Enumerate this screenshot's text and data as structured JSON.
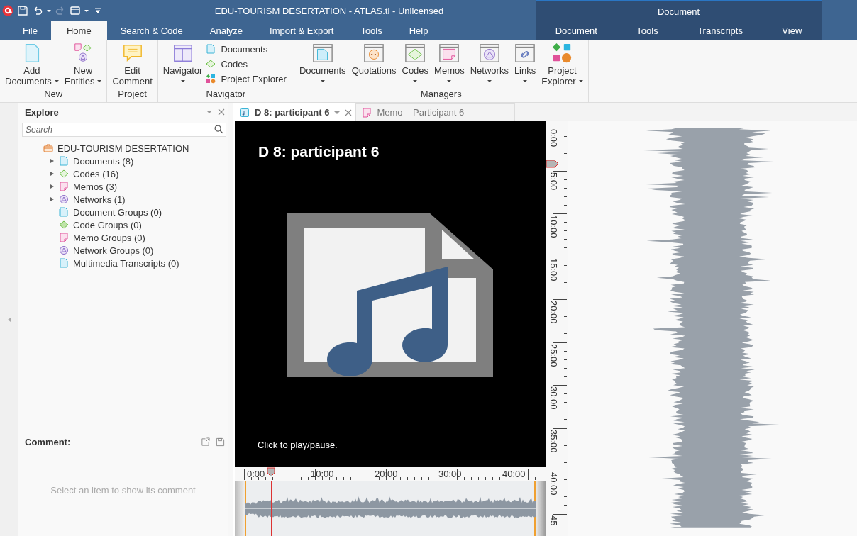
{
  "window": {
    "title": "EDU-TOURISM DESERTATION - ATLAS.ti - Unlicensed"
  },
  "menu_tabs": [
    {
      "label": "File",
      "selected": false
    },
    {
      "label": "Home",
      "selected": true
    },
    {
      "label": "Search & Code",
      "selected": false
    },
    {
      "label": "Analyze",
      "selected": false
    },
    {
      "label": "Import & Export",
      "selected": false
    },
    {
      "label": "Tools",
      "selected": false
    },
    {
      "label": "Help",
      "selected": false
    }
  ],
  "context_group": {
    "title": "Document",
    "tabs": [
      {
        "label": "Document",
        "selected": false
      },
      {
        "label": "Tools",
        "selected": false
      },
      {
        "label": "Transcripts",
        "selected": false
      },
      {
        "label": "View",
        "selected": false
      }
    ]
  },
  "ribbon": [
    {
      "title": "New",
      "items": [
        {
          "kind": "add-document",
          "lines": [
            "Add",
            "Documents"
          ],
          "dropdown": true
        },
        {
          "kind": "new-entities",
          "lines": [
            "New",
            "Entities"
          ],
          "dropdown": true
        }
      ]
    },
    {
      "title": "Project",
      "items": [
        {
          "kind": "edit-comment",
          "lines": [
            "Edit",
            "Comment"
          ],
          "dropdown": false
        }
      ]
    },
    {
      "title": "Navigator",
      "items": [
        {
          "kind": "navigator",
          "lines": [
            "Navigator"
          ],
          "dropdown": true
        },
        {
          "kind": "stack",
          "entries": [
            {
              "kind": "document",
              "label": "Documents"
            },
            {
              "kind": "code",
              "label": "Codes"
            },
            {
              "kind": "explorer",
              "label": "Project Explorer"
            }
          ]
        }
      ]
    },
    {
      "title": "Managers",
      "items": [
        {
          "kind": "mgr-documents",
          "lines": [
            "Documents"
          ],
          "dropdown": true
        },
        {
          "kind": "mgr-quotations",
          "lines": [
            "Quotations"
          ],
          "dropdown": false
        },
        {
          "kind": "mgr-codes",
          "lines": [
            "Codes"
          ],
          "dropdown": true
        },
        {
          "kind": "mgr-memos",
          "lines": [
            "Memos"
          ],
          "dropdown": true
        },
        {
          "kind": "mgr-networks",
          "lines": [
            "Networks"
          ],
          "dropdown": true
        },
        {
          "kind": "mgr-links",
          "lines": [
            "Links"
          ],
          "dropdown": true
        },
        {
          "kind": "project-explorer",
          "lines": [
            "Project",
            "Explorer"
          ],
          "dropdown": true
        }
      ]
    }
  ],
  "explore": {
    "title": "Explore",
    "search": {
      "placeholder": "Search"
    },
    "root": {
      "label": "EDU-TOURISM DESERTATION",
      "kind": "project",
      "children": [
        {
          "label": "Documents (8)",
          "kind": "document",
          "expanded": false
        },
        {
          "label": "Codes (16)",
          "kind": "code",
          "expanded": false
        },
        {
          "label": "Memos (3)",
          "kind": "memo",
          "expanded": false
        },
        {
          "label": "Networks (1)",
          "kind": "network",
          "expanded": false
        },
        {
          "label": "Document Groups (0)",
          "kind": "document-group"
        },
        {
          "label": "Code Groups (0)",
          "kind": "code-group"
        },
        {
          "label": "Memo Groups (0)",
          "kind": "memo-group"
        },
        {
          "label": "Network Groups (0)",
          "kind": "network-group"
        },
        {
          "label": "Multimedia Transcripts (0)",
          "kind": "document"
        }
      ]
    }
  },
  "comment": {
    "title": "Comment:",
    "empty_text": "Select an item to show its comment"
  },
  "editor_tabs": [
    {
      "label": "D 8: participant 6",
      "kind": "audio-document",
      "selected": true
    },
    {
      "label": "Memo – Participant 6",
      "kind": "memo",
      "selected": false
    }
  ],
  "media": {
    "title": "D 8: participant 6",
    "hint": "Click to play/pause.",
    "playhead": {
      "level": 0.093
    },
    "h_ruler": [
      "0:00",
      "10:00",
      "20:00",
      "30:00",
      "40:00"
    ],
    "v_ruler": [
      "0:00",
      "5:00",
      "10:00",
      "15:00",
      "20:00",
      "25:00",
      "30:00",
      "35:00",
      "40:00",
      "45"
    ]
  }
}
